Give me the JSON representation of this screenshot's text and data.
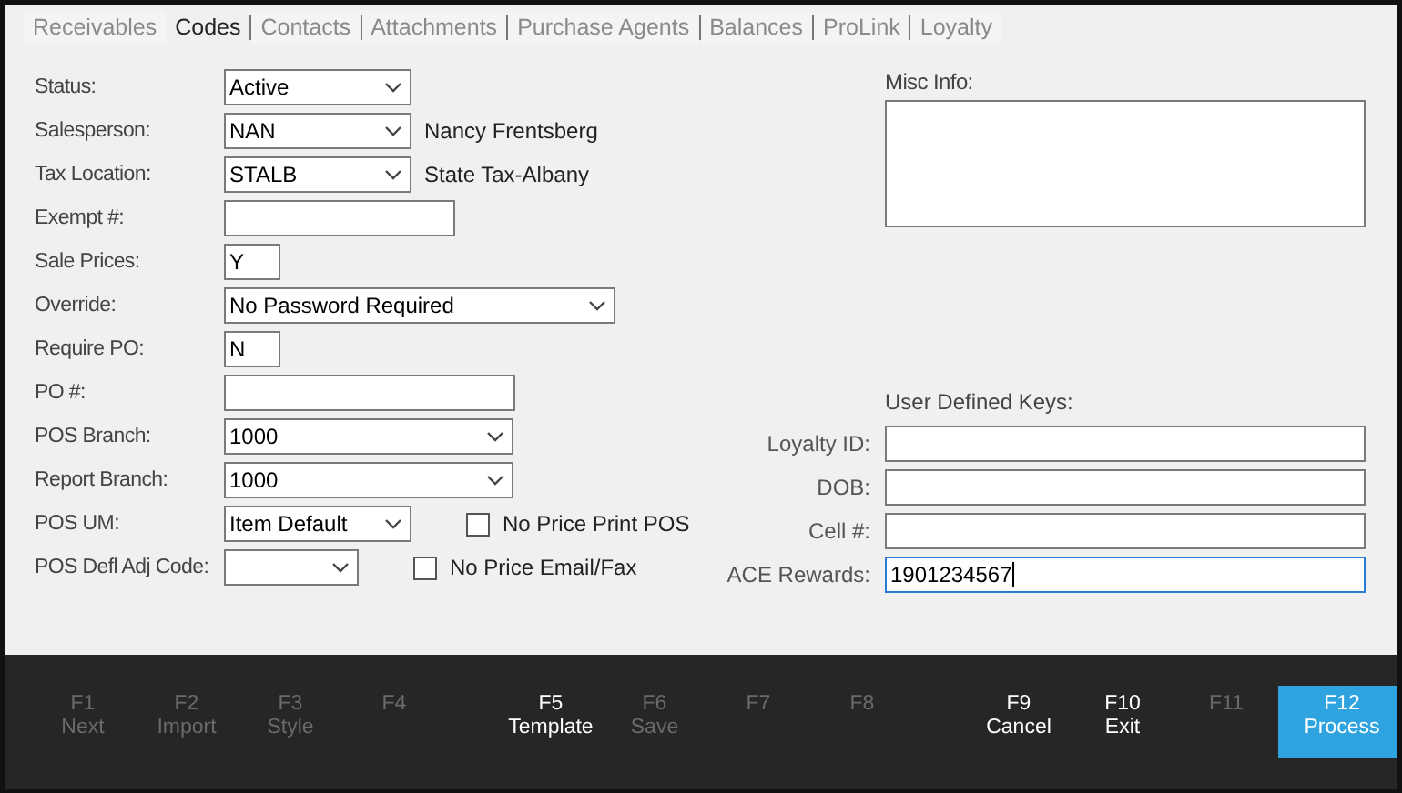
{
  "tabs": [
    {
      "label": "Receivables",
      "selected": false
    },
    {
      "label": "Codes",
      "selected": true
    },
    {
      "label": "Contacts",
      "selected": false
    },
    {
      "label": "Attachments",
      "selected": false
    },
    {
      "label": "Purchase Agents",
      "selected": false
    },
    {
      "label": "Balances",
      "selected": false
    },
    {
      "label": "ProLink",
      "selected": false
    },
    {
      "label": "Loyalty",
      "selected": false
    }
  ],
  "fields": [
    {
      "label": "Status:",
      "kind": "select",
      "value": "Active"
    },
    {
      "label": "Salesperson:",
      "kind": "select",
      "value": "NAN",
      "note": "Nancy Frentsberg"
    },
    {
      "label": "Tax Location:",
      "kind": "select",
      "value": "STALB",
      "note": "State Tax-Albany"
    },
    {
      "label": "Exempt #:",
      "kind": "text"
    },
    {
      "label": "Sale Prices:",
      "kind": "text",
      "value": "Y"
    },
    {
      "label": "Override:",
      "kind": "select",
      "value": "No Password Required"
    },
    {
      "label": "Require PO:",
      "kind": "text",
      "value": "N"
    },
    {
      "label": "PO #:",
      "kind": "text"
    },
    {
      "label": "POS Branch:",
      "kind": "select",
      "value": "1000"
    },
    {
      "label": "Report Branch:",
      "kind": "select",
      "value": "1000"
    },
    {
      "label": "POS UM:",
      "kind": "select",
      "value": "Item Default",
      "checkbox": {
        "label": "No Price Print POS",
        "checked": false
      }
    },
    {
      "label": "POS Defl Adj Code:",
      "kind": "select",
      "checkbox": {
        "label": "No Price Email/Fax",
        "checked": false
      }
    }
  ],
  "misc_info": {
    "label": "Misc Info:"
  },
  "user_defined_keys": {
    "title": "User Defined Keys:",
    "fields": [
      {
        "label": "Loyalty ID:",
        "focused": false
      },
      {
        "label": "DOB:",
        "focused": false
      },
      {
        "label": "Cell #:",
        "focused": false
      },
      {
        "label": "ACE Rewards:",
        "value": "1901234567",
        "focused": true
      }
    ]
  },
  "function_keys": [
    {
      "key": "F1",
      "label": "Next",
      "enabled": false,
      "primary": false
    },
    {
      "key": "F2",
      "label": "Import",
      "enabled": false,
      "primary": false
    },
    {
      "key": "F3",
      "label": "Style",
      "enabled": false,
      "primary": false
    },
    {
      "key": "F4",
      "enabled": false,
      "primary": false
    },
    {
      "key": "F5",
      "label": "Template",
      "enabled": true,
      "primary": false
    },
    {
      "key": "F6",
      "label": "Save",
      "enabled": false,
      "primary": false
    },
    {
      "key": "F7",
      "enabled": false,
      "primary": false
    },
    {
      "key": "F8",
      "enabled": false,
      "primary": false
    },
    {
      "key": "F9",
      "label": "Cancel",
      "enabled": true,
      "primary": false
    },
    {
      "key": "F10",
      "label": "Exit",
      "enabled": true,
      "primary": false
    },
    {
      "key": "F11",
      "enabled": false,
      "primary": false
    },
    {
      "key": "F12",
      "label": "Process",
      "enabled": true,
      "primary": true
    }
  ]
}
